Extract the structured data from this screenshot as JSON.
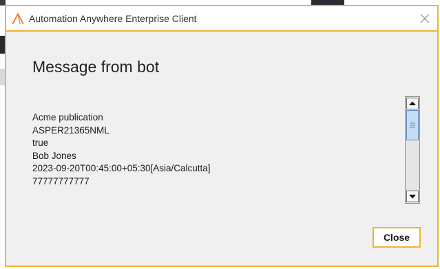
{
  "window": {
    "title": "Automation Anywhere Enterprise Client",
    "logo_icon": "automation-anywhere-logo",
    "close_icon": "close-x-icon",
    "accent_color": "#f3b233"
  },
  "dialog": {
    "heading": "Message from bot",
    "message_lines": [
      "Acme publication",
      "ASPER21365NML",
      "true",
      "Bob Jones",
      "2023-09-20T00:45:00+05:30[Asia/Calcutta]",
      "77777777777"
    ],
    "close_label": "Close"
  }
}
